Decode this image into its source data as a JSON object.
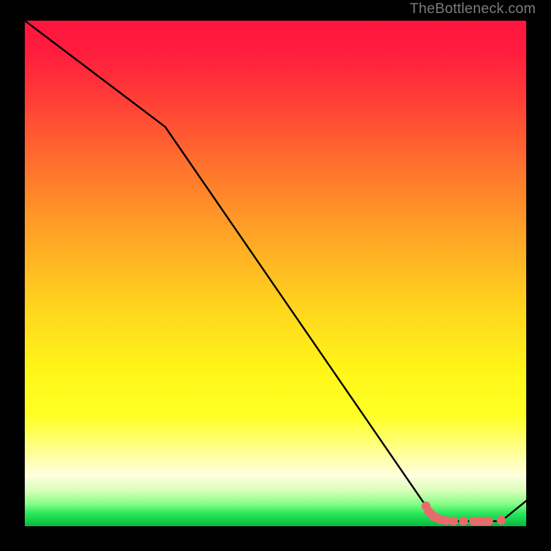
{
  "watermark": "TheBottleneck.com",
  "chart_data": {
    "type": "line",
    "title": "",
    "xlabel": "",
    "ylabel": "",
    "xlim": [
      0,
      100
    ],
    "ylim": [
      0,
      100
    ],
    "series": [
      {
        "name": "bottleneck-curve",
        "x": [
          0,
          28,
          80,
          83,
          95,
          100
        ],
        "y": [
          100,
          79,
          4,
          1,
          1,
          5
        ]
      }
    ],
    "markers": {
      "name": "highlighted-range",
      "color": "#e96a6c",
      "points": [
        {
          "x": 80.0,
          "y": 4.0
        },
        {
          "x": 80.5,
          "y": 3.0
        },
        {
          "x": 81.0,
          "y": 2.5
        },
        {
          "x": 81.5,
          "y": 2.0
        },
        {
          "x": 82.0,
          "y": 1.7
        },
        {
          "x": 82.5,
          "y": 1.5
        },
        {
          "x": 83.0,
          "y": 1.3
        },
        {
          "x": 84.0,
          "y": 1.1
        },
        {
          "x": 85.5,
          "y": 1.0
        },
        {
          "x": 87.5,
          "y": 1.0
        },
        {
          "x": 89.5,
          "y": 1.0
        },
        {
          "x": 90.5,
          "y": 1.0
        },
        {
          "x": 91.0,
          "y": 1.0
        },
        {
          "x": 92.0,
          "y": 1.0
        },
        {
          "x": 92.5,
          "y": 1.0
        },
        {
          "x": 95.0,
          "y": 1.2
        }
      ]
    }
  }
}
